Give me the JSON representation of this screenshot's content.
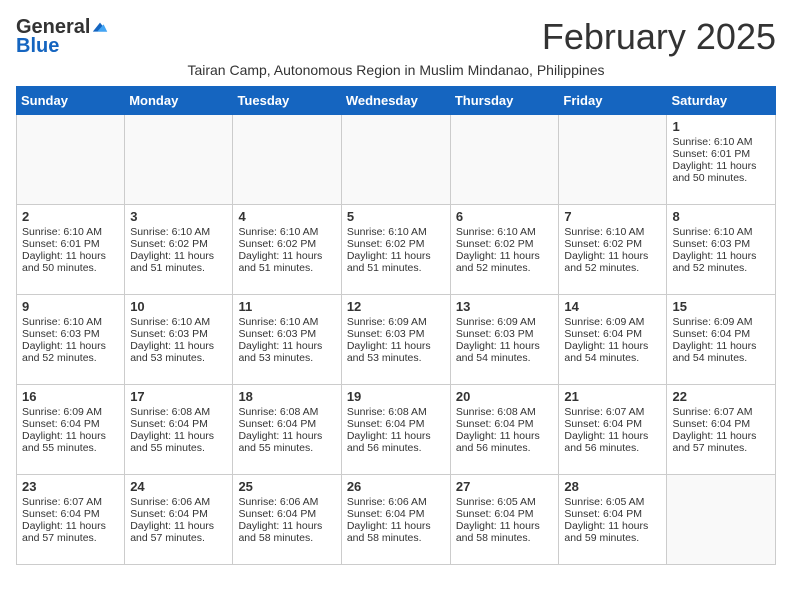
{
  "logo": {
    "general": "General",
    "blue": "Blue"
  },
  "title": "February 2025",
  "subtitle": "Tairan Camp, Autonomous Region in Muslim Mindanao, Philippines",
  "days_header": [
    "Sunday",
    "Monday",
    "Tuesday",
    "Wednesday",
    "Thursday",
    "Friday",
    "Saturday"
  ],
  "weeks": [
    [
      {
        "day": "",
        "sunrise": "",
        "sunset": "",
        "daylight": ""
      },
      {
        "day": "",
        "sunrise": "",
        "sunset": "",
        "daylight": ""
      },
      {
        "day": "",
        "sunrise": "",
        "sunset": "",
        "daylight": ""
      },
      {
        "day": "",
        "sunrise": "",
        "sunset": "",
        "daylight": ""
      },
      {
        "day": "",
        "sunrise": "",
        "sunset": "",
        "daylight": ""
      },
      {
        "day": "",
        "sunrise": "",
        "sunset": "",
        "daylight": ""
      },
      {
        "day": "1",
        "sunrise": "Sunrise: 6:10 AM",
        "sunset": "Sunset: 6:01 PM",
        "daylight": "Daylight: 11 hours and 50 minutes."
      }
    ],
    [
      {
        "day": "2",
        "sunrise": "Sunrise: 6:10 AM",
        "sunset": "Sunset: 6:01 PM",
        "daylight": "Daylight: 11 hours and 50 minutes."
      },
      {
        "day": "3",
        "sunrise": "Sunrise: 6:10 AM",
        "sunset": "Sunset: 6:02 PM",
        "daylight": "Daylight: 11 hours and 51 minutes."
      },
      {
        "day": "4",
        "sunrise": "Sunrise: 6:10 AM",
        "sunset": "Sunset: 6:02 PM",
        "daylight": "Daylight: 11 hours and 51 minutes."
      },
      {
        "day": "5",
        "sunrise": "Sunrise: 6:10 AM",
        "sunset": "Sunset: 6:02 PM",
        "daylight": "Daylight: 11 hours and 51 minutes."
      },
      {
        "day": "6",
        "sunrise": "Sunrise: 6:10 AM",
        "sunset": "Sunset: 6:02 PM",
        "daylight": "Daylight: 11 hours and 52 minutes."
      },
      {
        "day": "7",
        "sunrise": "Sunrise: 6:10 AM",
        "sunset": "Sunset: 6:02 PM",
        "daylight": "Daylight: 11 hours and 52 minutes."
      },
      {
        "day": "8",
        "sunrise": "Sunrise: 6:10 AM",
        "sunset": "Sunset: 6:03 PM",
        "daylight": "Daylight: 11 hours and 52 minutes."
      }
    ],
    [
      {
        "day": "9",
        "sunrise": "Sunrise: 6:10 AM",
        "sunset": "Sunset: 6:03 PM",
        "daylight": "Daylight: 11 hours and 52 minutes."
      },
      {
        "day": "10",
        "sunrise": "Sunrise: 6:10 AM",
        "sunset": "Sunset: 6:03 PM",
        "daylight": "Daylight: 11 hours and 53 minutes."
      },
      {
        "day": "11",
        "sunrise": "Sunrise: 6:10 AM",
        "sunset": "Sunset: 6:03 PM",
        "daylight": "Daylight: 11 hours and 53 minutes."
      },
      {
        "day": "12",
        "sunrise": "Sunrise: 6:09 AM",
        "sunset": "Sunset: 6:03 PM",
        "daylight": "Daylight: 11 hours and 53 minutes."
      },
      {
        "day": "13",
        "sunrise": "Sunrise: 6:09 AM",
        "sunset": "Sunset: 6:03 PM",
        "daylight": "Daylight: 11 hours and 54 minutes."
      },
      {
        "day": "14",
        "sunrise": "Sunrise: 6:09 AM",
        "sunset": "Sunset: 6:04 PM",
        "daylight": "Daylight: 11 hours and 54 minutes."
      },
      {
        "day": "15",
        "sunrise": "Sunrise: 6:09 AM",
        "sunset": "Sunset: 6:04 PM",
        "daylight": "Daylight: 11 hours and 54 minutes."
      }
    ],
    [
      {
        "day": "16",
        "sunrise": "Sunrise: 6:09 AM",
        "sunset": "Sunset: 6:04 PM",
        "daylight": "Daylight: 11 hours and 55 minutes."
      },
      {
        "day": "17",
        "sunrise": "Sunrise: 6:08 AM",
        "sunset": "Sunset: 6:04 PM",
        "daylight": "Daylight: 11 hours and 55 minutes."
      },
      {
        "day": "18",
        "sunrise": "Sunrise: 6:08 AM",
        "sunset": "Sunset: 6:04 PM",
        "daylight": "Daylight: 11 hours and 55 minutes."
      },
      {
        "day": "19",
        "sunrise": "Sunrise: 6:08 AM",
        "sunset": "Sunset: 6:04 PM",
        "daylight": "Daylight: 11 hours and 56 minutes."
      },
      {
        "day": "20",
        "sunrise": "Sunrise: 6:08 AM",
        "sunset": "Sunset: 6:04 PM",
        "daylight": "Daylight: 11 hours and 56 minutes."
      },
      {
        "day": "21",
        "sunrise": "Sunrise: 6:07 AM",
        "sunset": "Sunset: 6:04 PM",
        "daylight": "Daylight: 11 hours and 56 minutes."
      },
      {
        "day": "22",
        "sunrise": "Sunrise: 6:07 AM",
        "sunset": "Sunset: 6:04 PM",
        "daylight": "Daylight: 11 hours and 57 minutes."
      }
    ],
    [
      {
        "day": "23",
        "sunrise": "Sunrise: 6:07 AM",
        "sunset": "Sunset: 6:04 PM",
        "daylight": "Daylight: 11 hours and 57 minutes."
      },
      {
        "day": "24",
        "sunrise": "Sunrise: 6:06 AM",
        "sunset": "Sunset: 6:04 PM",
        "daylight": "Daylight: 11 hours and 57 minutes."
      },
      {
        "day": "25",
        "sunrise": "Sunrise: 6:06 AM",
        "sunset": "Sunset: 6:04 PM",
        "daylight": "Daylight: 11 hours and 58 minutes."
      },
      {
        "day": "26",
        "sunrise": "Sunrise: 6:06 AM",
        "sunset": "Sunset: 6:04 PM",
        "daylight": "Daylight: 11 hours and 58 minutes."
      },
      {
        "day": "27",
        "sunrise": "Sunrise: 6:05 AM",
        "sunset": "Sunset: 6:04 PM",
        "daylight": "Daylight: 11 hours and 58 minutes."
      },
      {
        "day": "28",
        "sunrise": "Sunrise: 6:05 AM",
        "sunset": "Sunset: 6:04 PM",
        "daylight": "Daylight: 11 hours and 59 minutes."
      },
      {
        "day": "",
        "sunrise": "",
        "sunset": "",
        "daylight": ""
      }
    ]
  ]
}
